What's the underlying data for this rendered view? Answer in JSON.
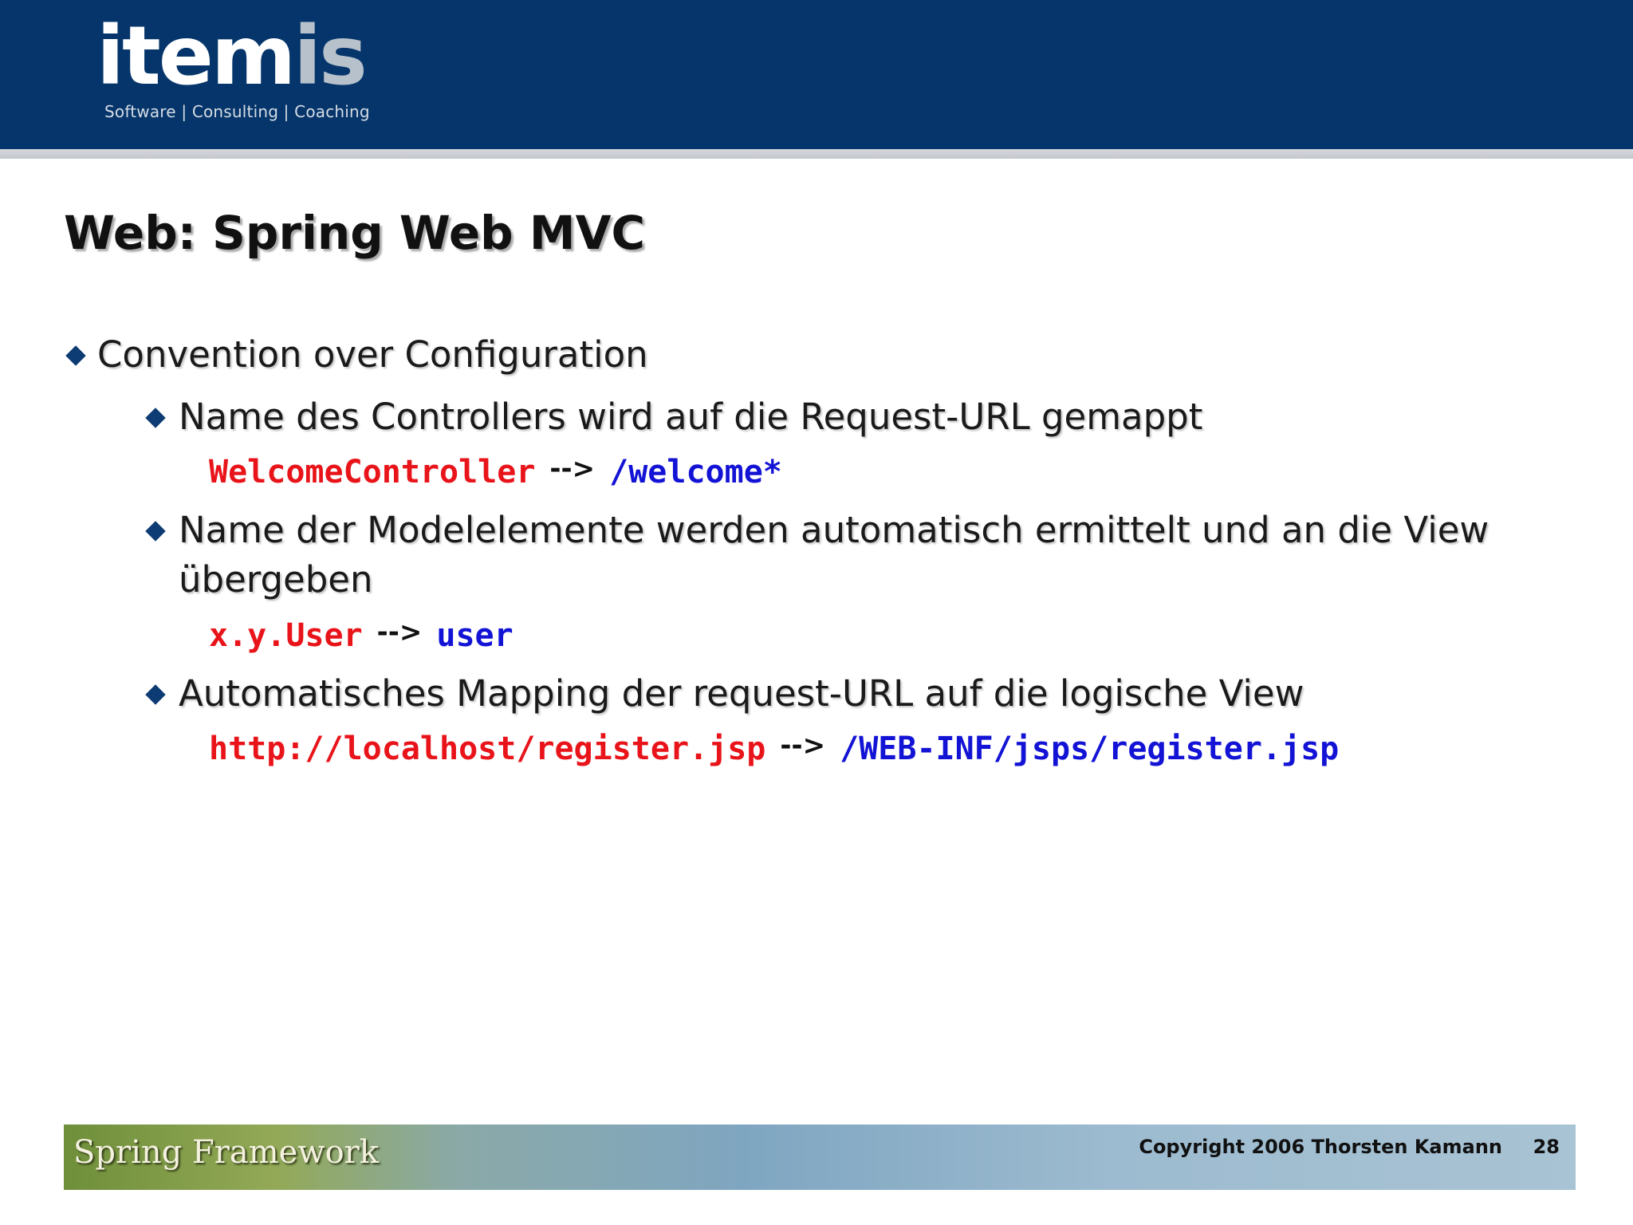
{
  "header": {
    "logo_part1": "item",
    "logo_part2": "is",
    "tagline": "Software | Consulting | Coaching"
  },
  "slide": {
    "title": "Web: Spring Web MVC",
    "bullets": [
      {
        "level": 1,
        "text": "Convention over Configuration"
      },
      {
        "level": 2,
        "text": "Name des Controllers wird auf die Request-URL gemappt",
        "example": {
          "left": "WelcomeController",
          "arrow": "-->",
          "right": "/welcome*"
        }
      },
      {
        "level": 2,
        "text_line1": "Name der Modelelemente werden automatisch ermittelt und an die View",
        "text_line2": "übergeben",
        "example": {
          "left": "x.y.User",
          "arrow": "-->",
          "right": "user"
        }
      },
      {
        "level": 2,
        "text": "Automatisches Mapping der request-URL auf die logische View",
        "example": {
          "left": "http://localhost/register.jsp",
          "arrow": "-->",
          "right": "/WEB-INF/jsps/register.jsp"
        }
      }
    ]
  },
  "footer": {
    "brand": "Spring Framework",
    "copyright": "Copyright 2006 Thorsten Kamann",
    "page_number": "28"
  },
  "colors": {
    "header_bg": "#05356a",
    "code_red": "#e8141a",
    "code_blue": "#1313d6",
    "bullet_diamond": "#0d3b73"
  }
}
